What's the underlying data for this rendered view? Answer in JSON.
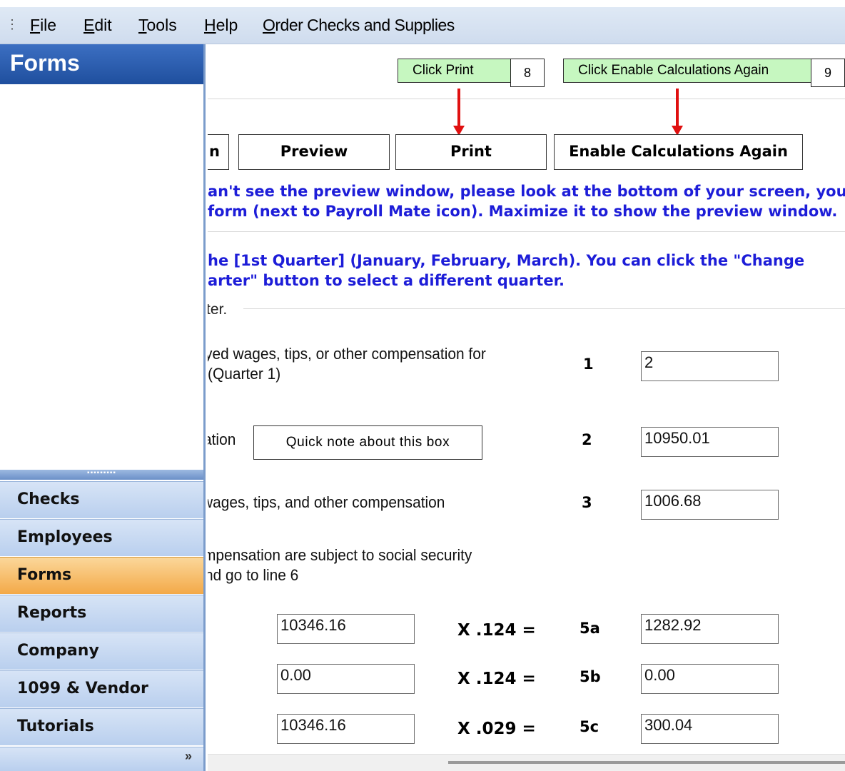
{
  "menu": {
    "grip": "⋮",
    "items": [
      {
        "underline": "F",
        "rest": "ile"
      },
      {
        "underline": "E",
        "rest": "dit"
      },
      {
        "underline": "T",
        "rest": "ools"
      },
      {
        "underline": "H",
        "rest": "elp"
      },
      {
        "underline": "O",
        "rest": "rder Checks and Supplies"
      }
    ]
  },
  "sidebar": {
    "title": "Forms",
    "splitter_grip": "▪▪▪▪▪▪▪▪▪",
    "items": [
      "Checks",
      "Employees",
      "Forms",
      "Reports",
      "Company",
      "1099 & Vendor",
      "Tutorials"
    ],
    "active": "Forms",
    "footer_chevron": "»"
  },
  "callouts": {
    "print": {
      "label": "Click Print",
      "number": "8"
    },
    "enable": {
      "label": "Click Enable Calculations Again",
      "number": "9"
    }
  },
  "buttons": {
    "partial": "n",
    "preview": "Preview",
    "print": "Print",
    "enable_calculations": "Enable Calculations Again"
  },
  "preview_notice": {
    "line1": "an't see the preview window, please look at the bottom of your screen, you",
    "line2": "form (next to Payroll Mate icon). Maximize it to show the preview window."
  },
  "quarter_notice": {
    "line1": "he [1st Quarter] (January, February, March). You can click the \"Change",
    "line2": "arter\" button to select a different quarter."
  },
  "section_legend": "ter.",
  "lines": {
    "line1": {
      "text1": "yed wages, tips, or other compensation for",
      "text2": "(Quarter 1)",
      "num": "1",
      "value": "2"
    },
    "line2": {
      "text": "ation",
      "num": "2",
      "value": "10950.01",
      "note": "Quick note about this box"
    },
    "line3": {
      "text": "wages, tips, and other compensation",
      "num": "3",
      "value": "1006.68"
    },
    "line4": {
      "text1": "mpensation are subject to social security",
      "text2": "nd go to line 6"
    },
    "line5a": {
      "amount": "10346.16",
      "calc": "X  .124 =",
      "num": "5a",
      "value": "1282.92"
    },
    "line5b": {
      "amount": "0.00",
      "calc": "X  .124 =",
      "num": "5b",
      "value": "0.00"
    },
    "line5c": {
      "amount": "10346.16",
      "calc": "X  .029 =",
      "num": "5c",
      "value": "300.04"
    }
  },
  "colors": {
    "callout_bg": "#c6f7c0",
    "arrow": "#e01010",
    "notice_text": "#1d1dd8",
    "active_nav": "#f3a948",
    "header_blue": "#1f4f9e"
  }
}
